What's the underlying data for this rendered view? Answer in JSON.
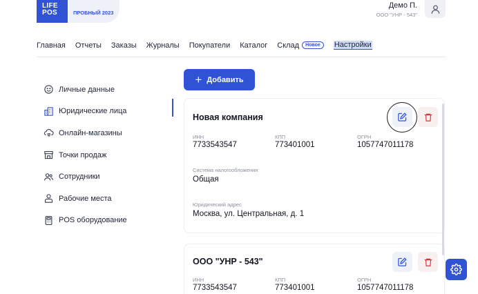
{
  "brand": {
    "logo_line1": "LIFE",
    "logo_line2": "POS",
    "trial_label": "ПРОБНЫЙ 2023",
    "accent_color": "#2f53d4"
  },
  "user": {
    "name": "Демо П.",
    "org": "ООО \"УНР - 543\"",
    "icon": "user-icon"
  },
  "nav": {
    "items": [
      {
        "label": "Главная"
      },
      {
        "label": "Отчеты"
      },
      {
        "label": "Заказы"
      },
      {
        "label": "Журналы"
      },
      {
        "label": "Покупатели"
      },
      {
        "label": "Каталог"
      },
      {
        "label": "Склад",
        "badge": "Новое"
      },
      {
        "label": "Настройки",
        "active": true
      }
    ]
  },
  "sidebar": {
    "items": [
      {
        "label": "Личные данные",
        "icon": "smile-icon"
      },
      {
        "label": "Юридические лица",
        "icon": "building-icon",
        "active": true
      },
      {
        "label": "Онлайн-магазины",
        "icon": "cloud-shop-icon"
      },
      {
        "label": "Точки продаж",
        "icon": "store-icon"
      },
      {
        "label": "Сотрудники",
        "icon": "users-icon"
      },
      {
        "label": "Рабочие места",
        "icon": "workplace-icon"
      },
      {
        "label": "POS оборудование",
        "icon": "pos-terminal-icon"
      }
    ]
  },
  "actions": {
    "add_label": "Добавить",
    "add_icon": "plus-icon",
    "edit_icon": "edit-icon",
    "delete_icon": "trash-icon",
    "settings_icon": "gear-icon"
  },
  "companies": [
    {
      "name": "Новая компания",
      "inn_label": "ИНН",
      "inn": "7733543547",
      "kpp_label": "КПП",
      "kpp": "773401001",
      "ogrn_label": "ОГРН",
      "ogrn": "1057747011178",
      "tax_label": "Система налогообложения",
      "tax": "Общая",
      "address_label": "Юридический адрес",
      "address": "Москва, ул. Центральная, д. 1"
    },
    {
      "name": "ООО \"УНР - 543\"",
      "inn_label": "ИНН",
      "inn": "7733543547",
      "kpp_label": "КПП",
      "kpp": "773401001",
      "ogrn_label": "ОГРН",
      "ogrn": "1057747011178"
    }
  ]
}
